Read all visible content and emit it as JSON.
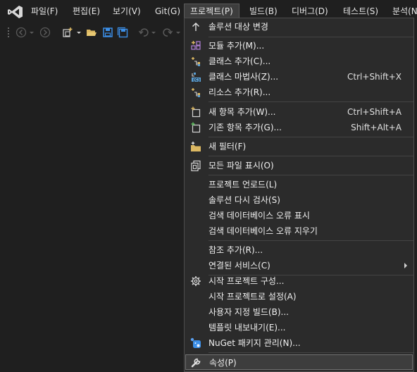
{
  "menubar": {
    "items": [
      {
        "label": "파일(F)"
      },
      {
        "label": "편집(E)"
      },
      {
        "label": "보기(V)"
      },
      {
        "label": "Git(G)"
      },
      {
        "label": "프로젝트(P)"
      },
      {
        "label": "빌드(B)"
      },
      {
        "label": "디버그(D)"
      },
      {
        "label": "테스트(S)"
      },
      {
        "label": "분석(N"
      }
    ]
  },
  "project_menu": {
    "items": [
      {
        "label": "솔루션 대상 변경",
        "icon": "arrow-up-icon"
      },
      {
        "label": "모듈 추가(M)...",
        "icon": "add-module-icon"
      },
      {
        "label": "클래스 추가(C)...",
        "icon": "add-class-icon"
      },
      {
        "label": "클래스 마법사(Z)...",
        "shortcut": "Ctrl+Shift+X",
        "icon": "class-wizard-icon"
      },
      {
        "label": "리소스 추가(R)...",
        "icon": "add-resource-icon"
      },
      {
        "label": "새 항목 추가(W)...",
        "shortcut": "Ctrl+Shift+A",
        "icon": "new-item-icon"
      },
      {
        "label": "기존 항목 추가(G)...",
        "shortcut": "Shift+Alt+A",
        "icon": "existing-item-icon"
      },
      {
        "label": "새 필터(F)",
        "icon": "new-filter-icon"
      },
      {
        "label": "모든 파일 표시(O)",
        "icon": "show-all-files-icon"
      },
      {
        "label": "프로젝트 언로드(L)"
      },
      {
        "label": "솔루션 다시 검사(S)"
      },
      {
        "label": "검색 데이터베이스 오류 표시"
      },
      {
        "label": "검색 데이터베이스 오류 지우기"
      },
      {
        "label": "참조 추가(R)..."
      },
      {
        "label": "연결된 서비스(C)"
      },
      {
        "label": "시작 프로젝트 구성...",
        "icon": "gear-icon"
      },
      {
        "label": "시작 프로젝트로 설정(A)"
      },
      {
        "label": "사용자 지정 빌드(B)..."
      },
      {
        "label": "템플릿 내보내기(E)..."
      },
      {
        "label": "NuGet 패키지 관리(N)...",
        "icon": "nuget-icon"
      },
      {
        "label": "속성(P)",
        "icon": "wrench-icon"
      }
    ]
  },
  "colors": {
    "background": "#1f1f1f",
    "menu_background": "#2b2b2b",
    "highlight": "#3d3d3d",
    "vs_purple": "#b180d7",
    "save_blue": "#3c8fe8",
    "folder_yellow": "#dcb862"
  }
}
